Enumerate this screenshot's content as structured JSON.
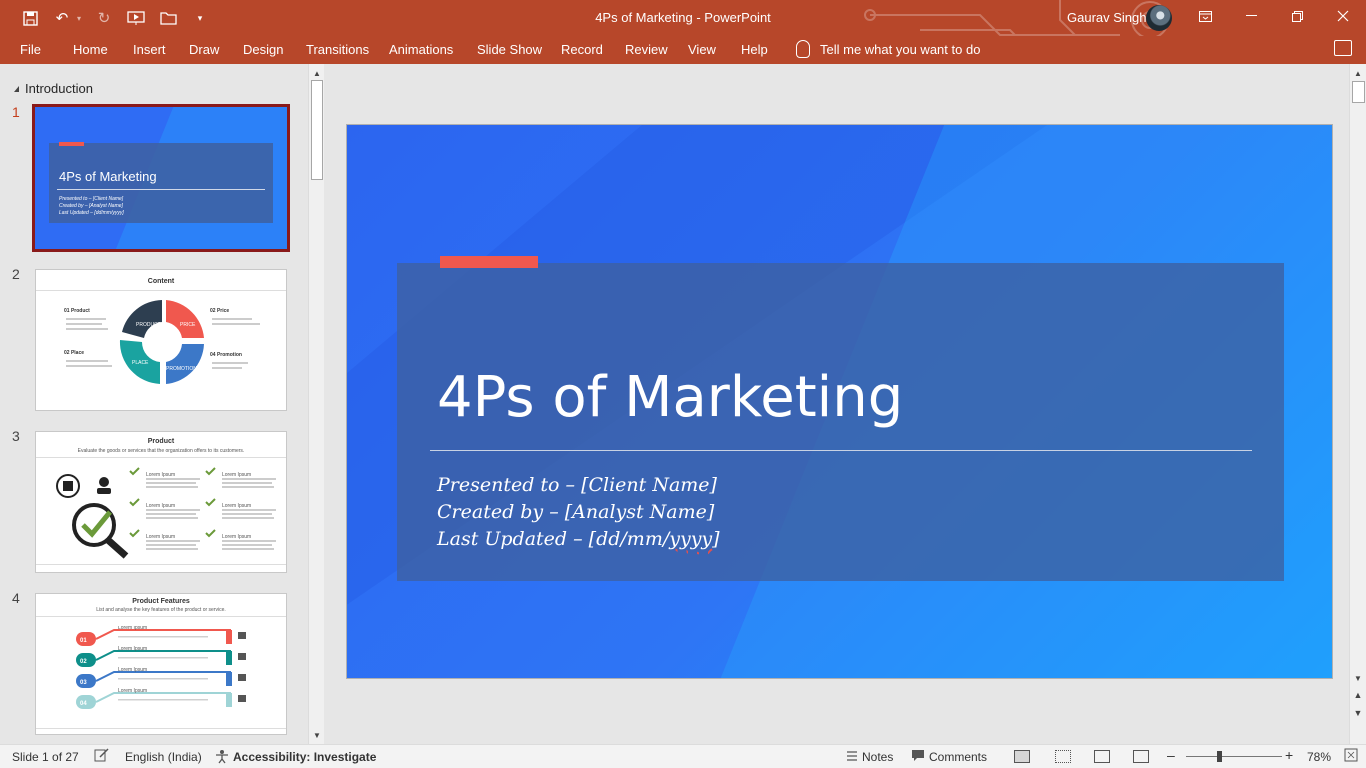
{
  "titlebar": {
    "document_title": "4Ps of Marketing - PowerPoint",
    "user_name": "Gaurav Singh",
    "qat_icons": [
      "save-icon",
      "undo-icon",
      "undo-dropdown-icon",
      "redo-icon",
      "slideshow-from-start-icon",
      "open-folder-icon",
      "customize-qat-icon"
    ],
    "window_buttons": [
      "ribbon-display-options-icon",
      "minimize-icon",
      "restore-icon",
      "close-icon"
    ]
  },
  "ribbon": {
    "tabs": [
      "File",
      "Home",
      "Insert",
      "Draw",
      "Design",
      "Transitions",
      "Animations",
      "Slide Show",
      "Record",
      "Review",
      "View",
      "Help"
    ],
    "tell_me": "Tell me what you want to do"
  },
  "thumbnails": {
    "section_name": "Introduction",
    "slides": [
      {
        "number": "1",
        "title": "4Ps of Marketing",
        "lines": [
          "Presented to – [Client Name]",
          "Created by – [Analyst Name]",
          "Last Updated – [dd/mm/yyyy]"
        ]
      },
      {
        "number": "2",
        "title": "Content",
        "items": [
          "01 Product",
          "02 Price",
          "02 Place",
          "04 Promotion"
        ],
        "wheel": [
          "PRODUCT",
          "PRICE",
          "PLACE",
          "PROMOTION"
        ]
      },
      {
        "number": "3",
        "title": "Product",
        "subtitle": "Evaluate the goods or services that the organization offers to its customers.",
        "item_label": "Lorem Ipsum"
      },
      {
        "number": "4",
        "title": "Product Features",
        "subtitle": "List and analyse the key features of the product or service.",
        "steps": [
          "01",
          "02",
          "03",
          "04"
        ],
        "step_label": "Lorem Ipsum"
      }
    ]
  },
  "slide": {
    "title": "4Ps of Marketing",
    "presented_to": "Presented to – [Client Name]",
    "created_by": "Created by – [Analyst Name]",
    "last_updated_prefix": "Last Updated – [dd/mm/",
    "last_updated_flagged": "yyyy",
    "last_updated_suffix": "]"
  },
  "statusbar": {
    "slide_counter": "Slide 1 of 27",
    "language": "English (India)",
    "accessibility": "Accessibility: Investigate",
    "notes": "Notes",
    "comments": "Comments",
    "zoom_minus": "–",
    "zoom_plus": "+",
    "zoom": "78%"
  },
  "colors": {
    "ribbon": "#b7472a",
    "slide_blue": "#2e6ff4",
    "accent_coral": "#f0584e",
    "active_thumb_border": "#8a1a1a"
  }
}
